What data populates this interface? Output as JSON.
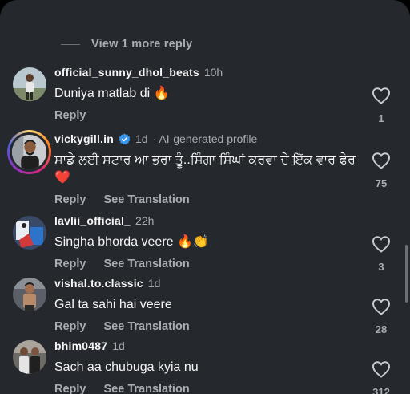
{
  "view_more_label": "View 1 more reply",
  "reply_label": "Reply",
  "translate_label": "See Translation",
  "comments": [
    {
      "username": "official_sunny_dhol_beats",
      "time": "10h",
      "text": "Duniya matlab di 🔥",
      "likes": "1"
    },
    {
      "username": "vickygill.in",
      "time": "1d",
      "ai_label": "· AI-generated profile",
      "text": "ਸਾਡੇ ਲਈ ਸਟਾਰ ਆ ਭਰਾ ਤੂੰ..ਸਿੰਗਾ ਸਿੰਘਾਂ ਕਰਵਾ ਦੇ ਇੱਕ ਵਾਰ ਫੇਰ ❤️",
      "likes": "75"
    },
    {
      "username": "lavlii_official_",
      "time": "22h",
      "text": "Singha bhorda veere 🔥👏",
      "likes": "3"
    },
    {
      "username": "vishal.to.classic",
      "time": "1d",
      "text": "Gal ta  sahi hai veere",
      "likes": "28"
    },
    {
      "username": "bhim0487",
      "time": "1d",
      "text": "Sach aa chubuga kyia nu",
      "likes": "312"
    }
  ]
}
